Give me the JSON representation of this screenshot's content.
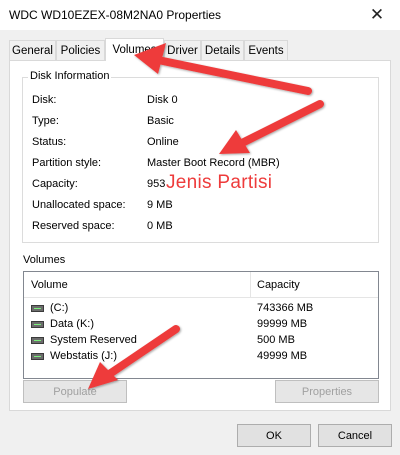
{
  "window": {
    "title": "WDC WD10EZEX-08M2NA0 Properties",
    "close_glyph": "✕"
  },
  "tabs": [
    {
      "label": "General",
      "active": false
    },
    {
      "label": "Policies",
      "active": false
    },
    {
      "label": "Volumes",
      "active": true
    },
    {
      "label": "Driver",
      "active": false
    },
    {
      "label": "Details",
      "active": false
    },
    {
      "label": "Events",
      "active": false
    }
  ],
  "disk_info": {
    "group_label": "Disk Information",
    "rows": [
      {
        "label": "Disk:",
        "value": "Disk 0"
      },
      {
        "label": "Type:",
        "value": "Basic"
      },
      {
        "label": "Status:",
        "value": "Online"
      },
      {
        "label": "Partition style:",
        "value": "Master Boot Record (MBR)"
      },
      {
        "label": "Capacity:",
        "value": "953"
      },
      {
        "label": "Unallocated space:",
        "value": "9 MB"
      },
      {
        "label": "Reserved space:",
        "value": "0 MB"
      }
    ]
  },
  "volumes": {
    "group_label": "Volumes",
    "columns": [
      "Volume",
      "Capacity"
    ],
    "rows": [
      {
        "name": "(C:)",
        "capacity": "743366 MB",
        "icon": "disk-icon"
      },
      {
        "name": "Data (K:)",
        "capacity": "99999 MB",
        "icon": "disk-icon"
      },
      {
        "name": "System Reserved",
        "capacity": "500 MB",
        "icon": "disk-icon"
      },
      {
        "name": "Webstatis (J:)",
        "capacity": "49999 MB",
        "icon": "disk-icon"
      }
    ]
  },
  "buttons": {
    "populate": "Populate",
    "properties": "Properties",
    "ok": "OK",
    "cancel": "Cancel"
  },
  "annotation": {
    "text": "Jenis Partisi",
    "color": "#ee3b3b"
  }
}
